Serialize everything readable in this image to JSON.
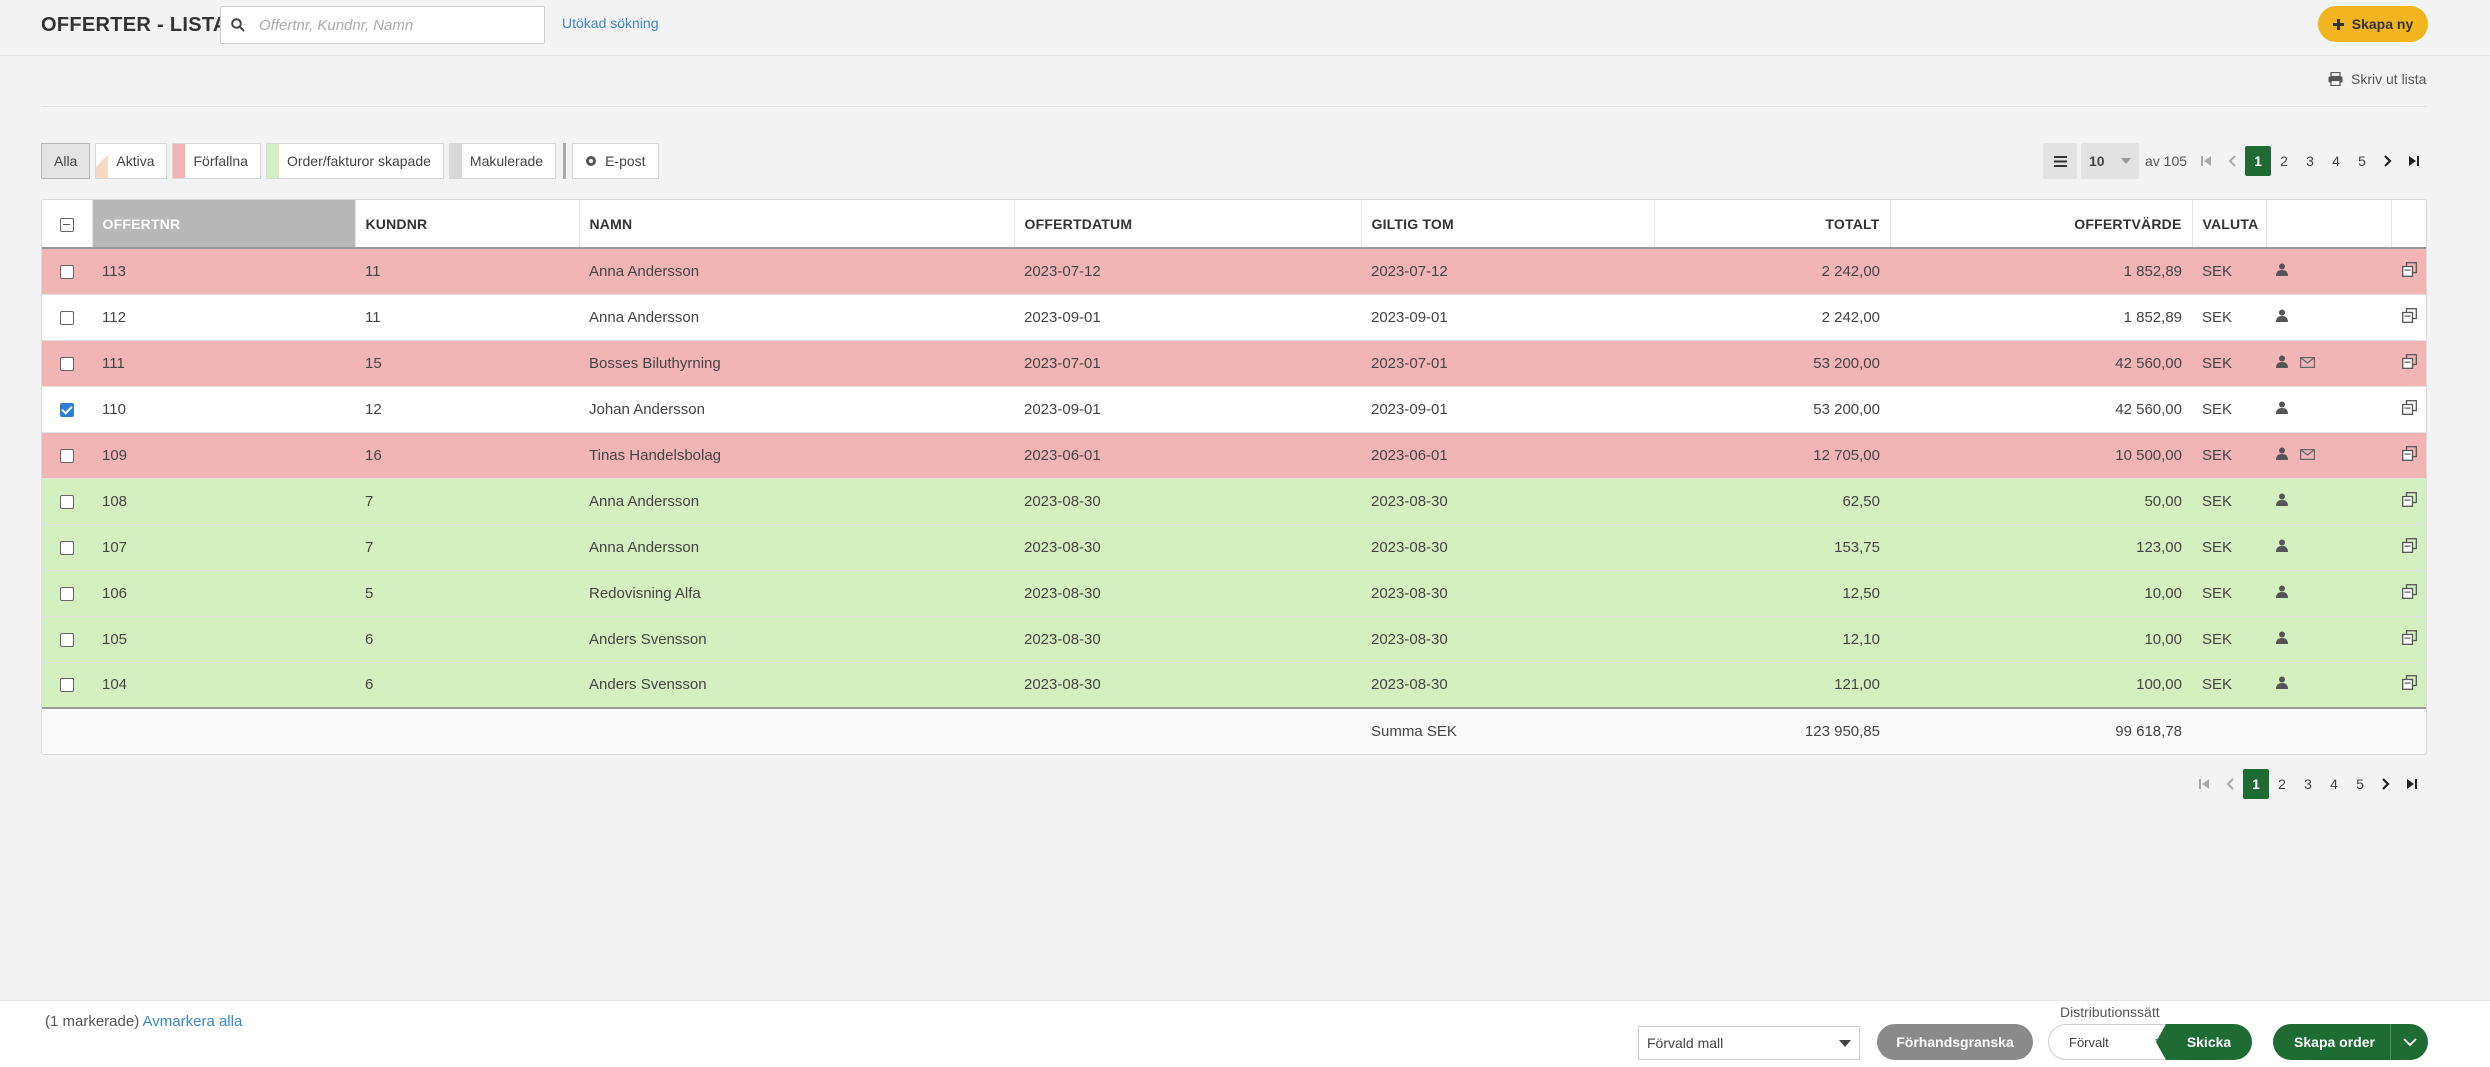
{
  "header": {
    "title": "OFFERTER - LISTA",
    "search_placeholder": "Offertnr, Kundnr, Namn",
    "advanced_search": "Utökad sökning",
    "create_label": "Skapa ny",
    "print_label": "Skriv ut lista"
  },
  "filters": [
    {
      "label": "Alla",
      "active": true
    },
    {
      "label": "Aktiva",
      "swatch": "#f7d8c0"
    },
    {
      "label": "Förfallna",
      "swatch": "#f2b5b5"
    },
    {
      "label": "Order/fakturor skapade",
      "swatch": "#d5f0c0"
    },
    {
      "label": "Makulerade",
      "swatch": "#d8d8d8"
    }
  ],
  "email_filter": "E-post",
  "pagination": {
    "page_size": "10",
    "of_total": "av 105",
    "pages": [
      "1",
      "2",
      "3",
      "4",
      "5"
    ],
    "current": "1"
  },
  "table": {
    "columns": {
      "offertnr": "OFFERTNR",
      "kundnr": "KUNDNR",
      "namn": "NAMN",
      "offertdatum": "OFFERTDATUM",
      "giltig": "GILTIG TOM",
      "totalt": "TOTALT",
      "offertvarde": "OFFERTVÄRDE",
      "valuta": "VALUTA"
    },
    "rows": [
      {
        "status": "red",
        "checked": false,
        "offertnr": "113",
        "kundnr": "11",
        "namn": "Anna Andersson",
        "offertdatum": "2023-07-12",
        "giltig": "2023-07-12",
        "totalt": "2 242,00",
        "offertvarde": "1 852,89",
        "valuta": "SEK",
        "email": false
      },
      {
        "status": "white",
        "checked": false,
        "offertnr": "112",
        "kundnr": "11",
        "namn": "Anna Andersson",
        "offertdatum": "2023-09-01",
        "giltig": "2023-09-01",
        "totalt": "2 242,00",
        "offertvarde": "1 852,89",
        "valuta": "SEK",
        "email": false
      },
      {
        "status": "red",
        "checked": false,
        "offertnr": "111",
        "kundnr": "15",
        "namn": "Bosses Biluthyrning",
        "offertdatum": "2023-07-01",
        "giltig": "2023-07-01",
        "totalt": "53 200,00",
        "offertvarde": "42 560,00",
        "valuta": "SEK",
        "email": true
      },
      {
        "status": "white",
        "checked": true,
        "offertnr": "110",
        "kundnr": "12",
        "namn": "Johan Andersson",
        "offertdatum": "2023-09-01",
        "giltig": "2023-09-01",
        "totalt": "53 200,00",
        "offertvarde": "42 560,00",
        "valuta": "SEK",
        "email": false
      },
      {
        "status": "red",
        "checked": false,
        "offertnr": "109",
        "kundnr": "16",
        "namn": "Tinas Handelsbolag",
        "offertdatum": "2023-06-01",
        "giltig": "2023-06-01",
        "totalt": "12 705,00",
        "offertvarde": "10 500,00",
        "valuta": "SEK",
        "email": true
      },
      {
        "status": "green",
        "checked": false,
        "offertnr": "108",
        "kundnr": "7",
        "namn": "Anna Andersson",
        "offertdatum": "2023-08-30",
        "giltig": "2023-08-30",
        "totalt": "62,50",
        "offertvarde": "50,00",
        "valuta": "SEK",
        "email": false
      },
      {
        "status": "green",
        "checked": false,
        "offertnr": "107",
        "kundnr": "7",
        "namn": "Anna Andersson",
        "offertdatum": "2023-08-30",
        "giltig": "2023-08-30",
        "totalt": "153,75",
        "offertvarde": "123,00",
        "valuta": "SEK",
        "email": false
      },
      {
        "status": "green",
        "checked": false,
        "offertnr": "106",
        "kundnr": "5",
        "namn": "Redovisning Alfa",
        "offertdatum": "2023-08-30",
        "giltig": "2023-08-30",
        "totalt": "12,50",
        "offertvarde": "10,00",
        "valuta": "SEK",
        "email": false
      },
      {
        "status": "green",
        "checked": false,
        "offertnr": "105",
        "kundnr": "6",
        "namn": "Anders Svensson",
        "offertdatum": "2023-08-30",
        "giltig": "2023-08-30",
        "totalt": "12,10",
        "offertvarde": "10,00",
        "valuta": "SEK",
        "email": false
      },
      {
        "status": "green",
        "checked": false,
        "offertnr": "104",
        "kundnr": "6",
        "namn": "Anders Svensson",
        "offertdatum": "2023-08-30",
        "giltig": "2023-08-30",
        "totalt": "121,00",
        "offertvarde": "100,00",
        "valuta": "SEK",
        "email": false
      }
    ],
    "summary": {
      "label": "Summa SEK",
      "totalt": "123 950,85",
      "offertvarde": "99 618,78"
    }
  },
  "bottom": {
    "selected_count": "(1 markerade)",
    "deselect_all": "Avmarkera alla",
    "template": "Förvald mall",
    "preview": "Förhandsgranska",
    "distribution_label": "Distributionssätt",
    "distribution_value": "Förvalt",
    "send": "Skicka",
    "create_order": "Skapa order"
  },
  "colors": {
    "accent_green": "#1e6b34",
    "create_yellow": "#f2b51f",
    "row_overdue": "#f2b5b5",
    "row_created": "#d5f0c0",
    "link_blue": "#3b87c9"
  },
  "icons": [
    "search-icon",
    "plus-icon",
    "printer-icon",
    "gear-icon",
    "list-icon",
    "user-icon",
    "envelope-icon",
    "copy-icon",
    "chevron-down-icon"
  ]
}
